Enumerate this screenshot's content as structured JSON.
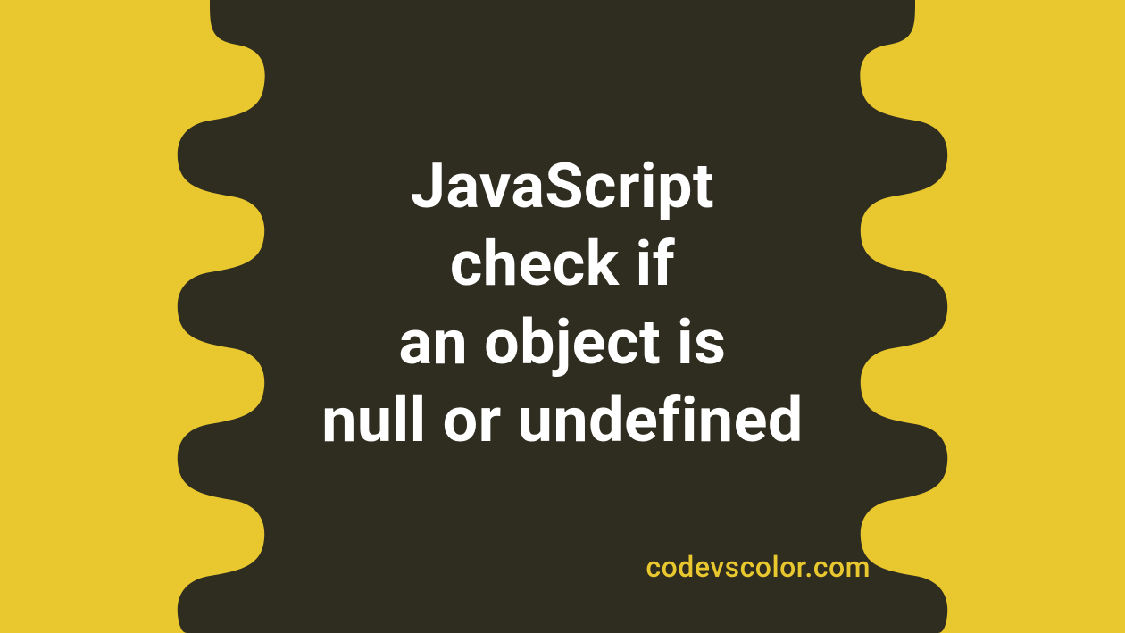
{
  "title": "JavaScript\ncheck if\nan object is\nnull or undefined",
  "watermark": "codevscolor.com",
  "colors": {
    "background": "#e8c82e",
    "blob": "#2f2c20",
    "titleText": "#ffffff",
    "watermarkText": "#e8c82e"
  }
}
